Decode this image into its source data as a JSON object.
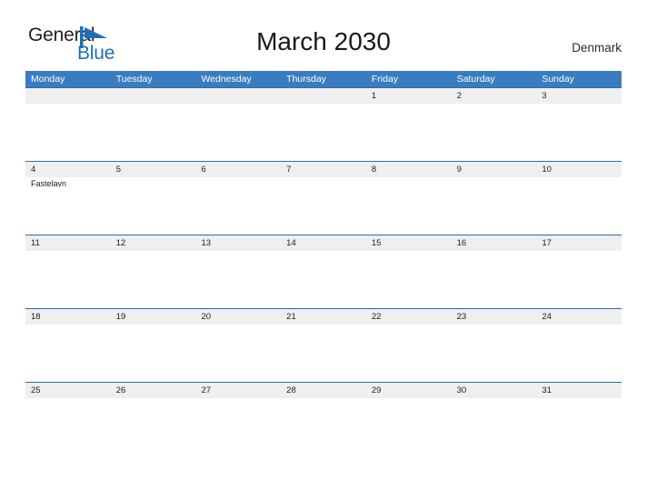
{
  "brand": {
    "name_top": "General",
    "name_bottom": "Blue",
    "accent_color": "#1e6fb5",
    "mark": "pennant-triangle"
  },
  "header": {
    "title": "March 2030",
    "country": "Denmark"
  },
  "calendar": {
    "header_bg": "#3a7cc0",
    "row_divider": "#2e6da4",
    "date_strip_bg": "#efefef",
    "weekdays": [
      "Monday",
      "Tuesday",
      "Wednesday",
      "Thursday",
      "Friday",
      "Saturday",
      "Sunday"
    ],
    "weeks": [
      [
        {
          "date": "",
          "event": ""
        },
        {
          "date": "",
          "event": ""
        },
        {
          "date": "",
          "event": ""
        },
        {
          "date": "",
          "event": ""
        },
        {
          "date": "1",
          "event": ""
        },
        {
          "date": "2",
          "event": ""
        },
        {
          "date": "3",
          "event": ""
        }
      ],
      [
        {
          "date": "4",
          "event": "Fastelavn"
        },
        {
          "date": "5",
          "event": ""
        },
        {
          "date": "6",
          "event": ""
        },
        {
          "date": "7",
          "event": ""
        },
        {
          "date": "8",
          "event": ""
        },
        {
          "date": "9",
          "event": ""
        },
        {
          "date": "10",
          "event": ""
        }
      ],
      [
        {
          "date": "11",
          "event": ""
        },
        {
          "date": "12",
          "event": ""
        },
        {
          "date": "13",
          "event": ""
        },
        {
          "date": "14",
          "event": ""
        },
        {
          "date": "15",
          "event": ""
        },
        {
          "date": "16",
          "event": ""
        },
        {
          "date": "17",
          "event": ""
        }
      ],
      [
        {
          "date": "18",
          "event": ""
        },
        {
          "date": "19",
          "event": ""
        },
        {
          "date": "20",
          "event": ""
        },
        {
          "date": "21",
          "event": ""
        },
        {
          "date": "22",
          "event": ""
        },
        {
          "date": "23",
          "event": ""
        },
        {
          "date": "24",
          "event": ""
        }
      ],
      [
        {
          "date": "25",
          "event": ""
        },
        {
          "date": "26",
          "event": ""
        },
        {
          "date": "27",
          "event": ""
        },
        {
          "date": "28",
          "event": ""
        },
        {
          "date": "29",
          "event": ""
        },
        {
          "date": "30",
          "event": ""
        },
        {
          "date": "31",
          "event": ""
        }
      ]
    ]
  }
}
